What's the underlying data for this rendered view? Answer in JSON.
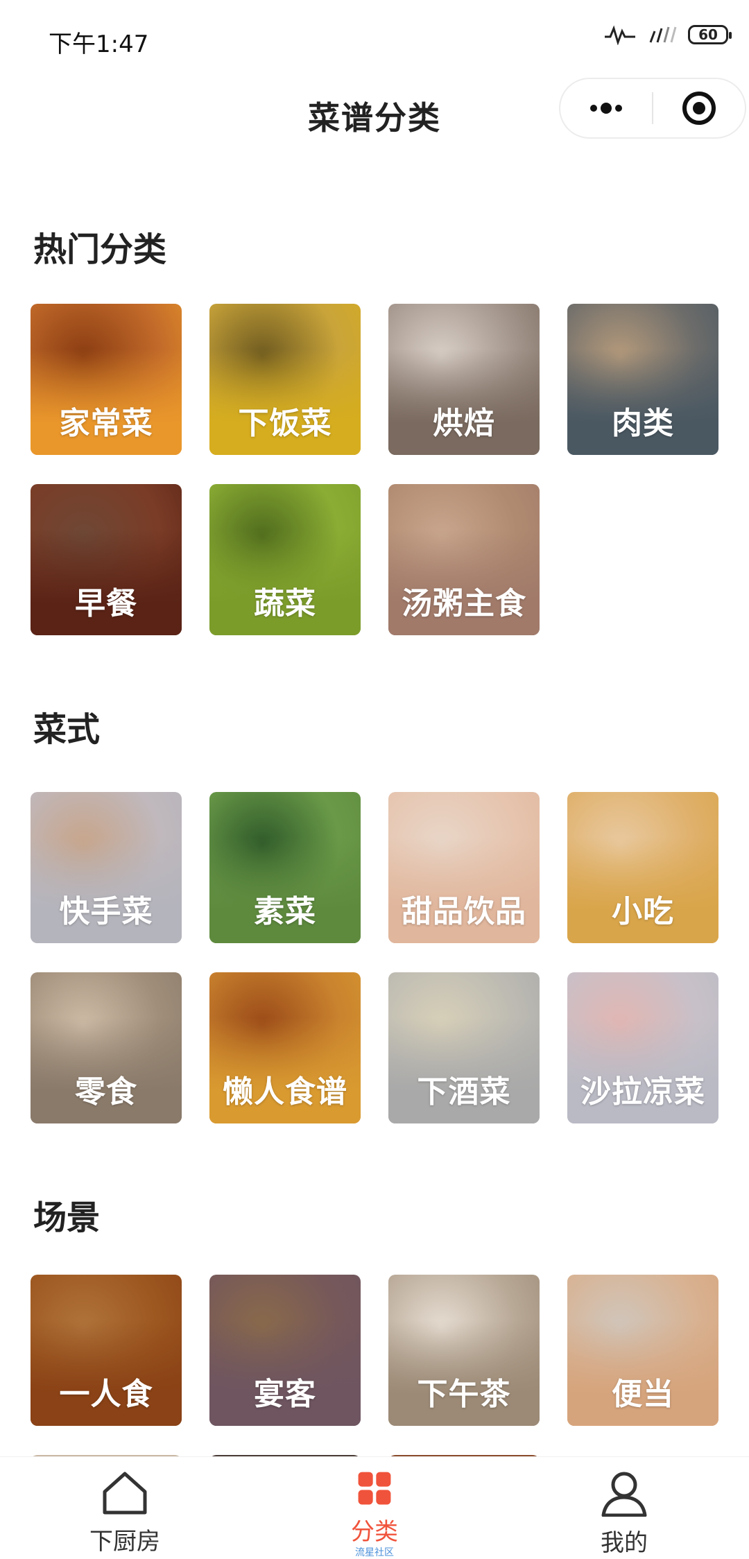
{
  "status_bar": {
    "time": "下午1:47",
    "battery": "60"
  },
  "header": {
    "title": "菜谱分类"
  },
  "sections": [
    {
      "title": "热门分类",
      "items": [
        {
          "label": "家常菜",
          "color": "#e9972b",
          "photo": [
            "#8a3c12",
            "#c26a2a",
            "#e9972b"
          ]
        },
        {
          "label": "下饭菜",
          "color": "#d6ad1e",
          "photo": [
            "#6e5a20",
            "#c9a43a",
            "#d6ad1e"
          ]
        },
        {
          "label": "烘焙",
          "color": "#7a6a5f",
          "photo": [
            "#d9cfc7",
            "#a2948a",
            "#7a6a5f"
          ]
        },
        {
          "label": "肉类",
          "color": "#4a5862",
          "photo": [
            "#b59a7b",
            "#6c6c6a",
            "#4a5862"
          ]
        },
        {
          "label": "早餐",
          "color": "#5a2316",
          "photo": [
            "#6e4836",
            "#7a3c26",
            "#5a2316"
          ]
        },
        {
          "label": "蔬菜",
          "color": "#7c9c2a",
          "photo": [
            "#4f6b1d",
            "#8bad34",
            "#7c9c2a"
          ]
        },
        {
          "label": "汤粥主食",
          "color": "#a17a6a",
          "photo": [
            "#c9a68e",
            "#b08a70",
            "#a17a6a"
          ]
        }
      ]
    },
    {
      "title": "菜式",
      "items": [
        {
          "label": "快手菜",
          "color": "#b4b4bc",
          "photo": [
            "#c8a58a",
            "#c0b8bc",
            "#b4b4bc"
          ]
        },
        {
          "label": "素菜",
          "color": "#5e8a3e",
          "photo": [
            "#2f5a2a",
            "#6a9a48",
            "#5e8a3e"
          ]
        },
        {
          "label": "甜品饮品",
          "color": "#e0b69c",
          "photo": [
            "#e8d6c8",
            "#e6c4ae",
            "#e0b69c"
          ]
        },
        {
          "label": "小吃",
          "color": "#d9a54a",
          "photo": [
            "#e9c9a0",
            "#dfb06a",
            "#d9a54a"
          ]
        },
        {
          "label": "零食",
          "color": "#8a7a6a",
          "photo": [
            "#cdbba6",
            "#a08e7a",
            "#8a7a6a"
          ]
        },
        {
          "label": "懒人食谱",
          "color": "#d99a30",
          "photo": [
            "#9a4a18",
            "#c9822e",
            "#d99a30"
          ]
        },
        {
          "label": "下酒菜",
          "color": "#a9a9a9",
          "photo": [
            "#d8d0b8",
            "#bcbab2",
            "#a9a9a9"
          ]
        },
        {
          "label": "沙拉凉菜",
          "color": "#b9bac4",
          "photo": [
            "#e2b6b2",
            "#c8c0c8",
            "#b9bac4"
          ]
        }
      ]
    },
    {
      "title": "场景",
      "items": [
        {
          "label": "一人食",
          "color": "#8a4216",
          "photo": [
            "#b0743a",
            "#9c561f",
            "#8a4216"
          ]
        },
        {
          "label": "宴客",
          "color": "#6e5560",
          "photo": [
            "#8a6a4a",
            "#76585a",
            "#6e5560"
          ]
        },
        {
          "label": "下午茶",
          "color": "#9c8a76",
          "photo": [
            "#e6ddd2",
            "#b7a795",
            "#9c8a76"
          ]
        },
        {
          "label": "便当",
          "color": "#d6a47c",
          "photo": [
            "#d0c6bc",
            "#d8b292",
            "#d6a47c"
          ]
        }
      ]
    }
  ],
  "tab_bar": {
    "active_color": "#f0533b",
    "tabs": [
      {
        "label": "下厨房",
        "icon": "home-icon",
        "active": false
      },
      {
        "label": "分类",
        "icon": "category-grid-icon",
        "active": true,
        "sub": "流星社区"
      },
      {
        "label": "我的",
        "icon": "profile-icon",
        "active": false
      }
    ]
  }
}
